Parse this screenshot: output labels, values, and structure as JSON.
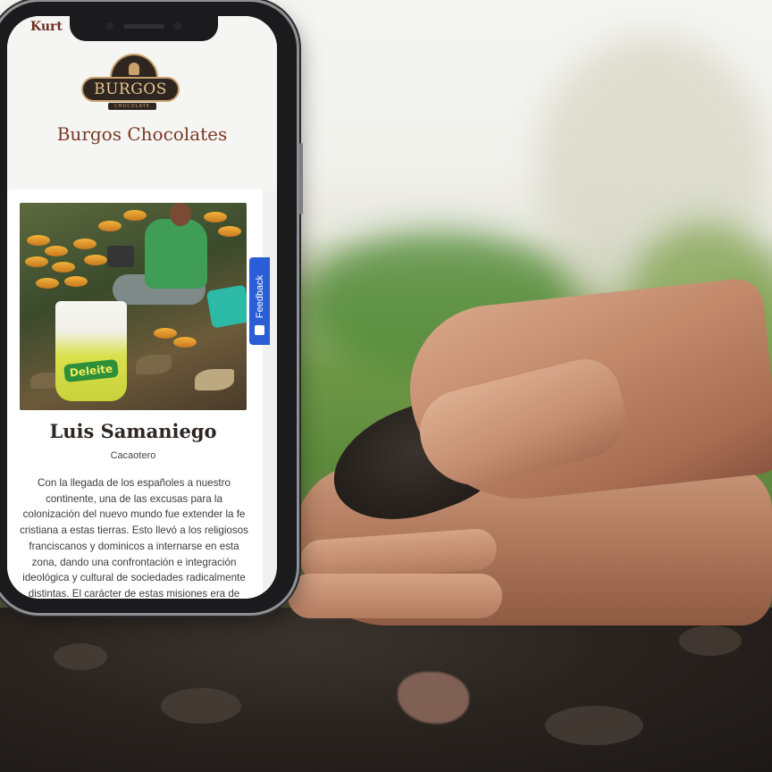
{
  "brand": {
    "logo_text": "BURGOS",
    "logo_subtext": "CHOCOLATE",
    "title": "Burgos Chocolates",
    "peek_text": "Kurt"
  },
  "profile": {
    "name": "Luis Samaniego",
    "role": "Cacaotero",
    "bio": "Con la llegada de los españoles a nuestro continente, una de las excusas para la colonización del nuevo mundo fue extender la fe cristiana a estas tierras. Esto llevó a los religiosos franciscanos y dominicos a internarse en esta zona, dando una confrontación e integración ideológica y cultural de sociedades radicalmente distintas. El carácter de estas misiones era de tipo",
    "photo_bucket_label": "Deleite"
  },
  "feedback": {
    "label": "Feedback"
  },
  "colors": {
    "brand_brown": "#7b3a24",
    "feedback_blue": "#2a5dd6",
    "logo_gold": "#c9a26b"
  },
  "icons": [
    "feedback-icon"
  ]
}
